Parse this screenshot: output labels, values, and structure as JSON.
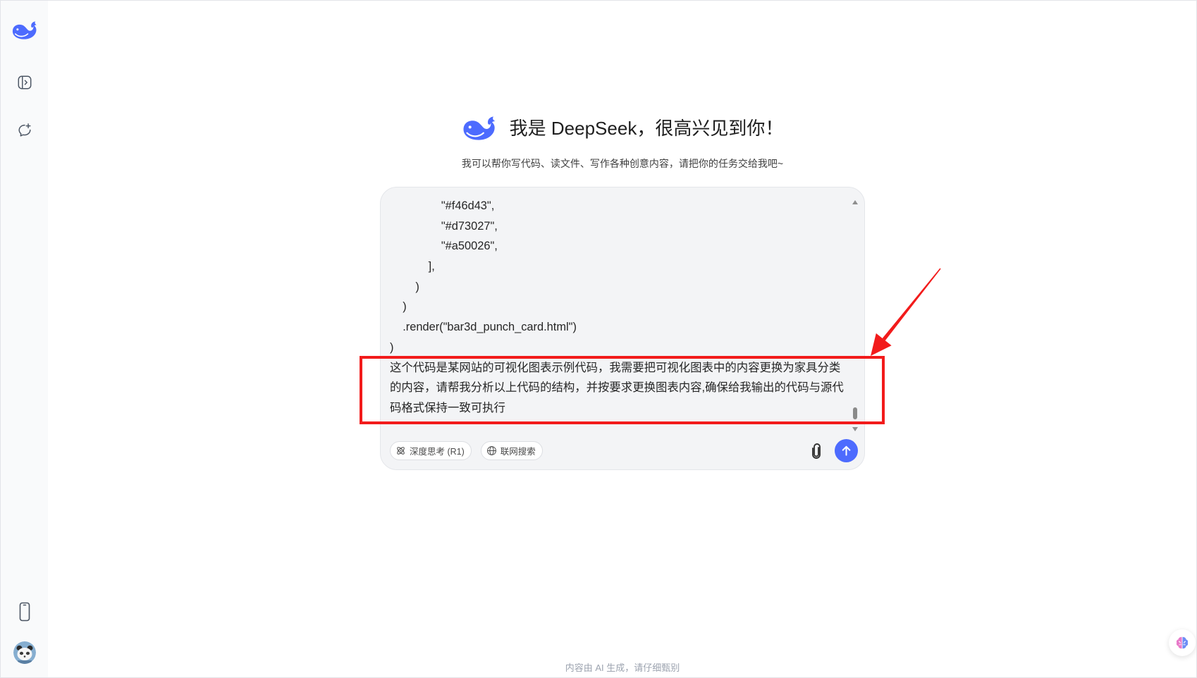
{
  "colors": {
    "accent": "#4d6bfe",
    "annotation_red": "#f21b1b",
    "composer_bg": "#f3f4f6",
    "sidebar_bg": "#f9fafb"
  },
  "sidebar": {
    "logo_icon": "deepseek-whale-logo-icon",
    "toggle_icon": "sidebar-toggle-icon",
    "new_chat_icon": "new-chat-icon",
    "app_icon": "mobile-phone-icon",
    "avatar_icon": "user-avatar"
  },
  "welcome": {
    "logo_icon": "deepseek-whale-logo-icon",
    "title": "我是 DeepSeek，很高兴见到你！",
    "subtitle": "我可以帮你写代码、读文件、写作各种创意内容，请把你的任务交给我吧~"
  },
  "composer": {
    "lines": [
      "                \"#f46d43\",",
      "                \"#d73027\",",
      "                \"#a50026\",",
      "            ],",
      "        )",
      "    )",
      "    .render(\"bar3d_punch_card.html\")",
      ")",
      "这个代码是某网站的可视化图表示例代码，我需要把可视化图表中的内容更换为家具分类",
      "的内容，请帮我分析以上代码的结构，并按要求更换图表内容,确保给我输出的代码与源代",
      "码格式保持一致可执行"
    ],
    "scroll_fraction": 1.0,
    "deep_think": {
      "icon": "atom-icon",
      "label": "深度思考 (R1)"
    },
    "web_search": {
      "icon": "globe-icon",
      "label": "联网搜索"
    },
    "attach_icon": "paperclip-icon",
    "send_icon": "arrow-up-icon"
  },
  "footer": {
    "disclaimer": "内容由 AI 生成，请仔细甄别"
  },
  "floating_button": {
    "icon": "brain-icon"
  }
}
